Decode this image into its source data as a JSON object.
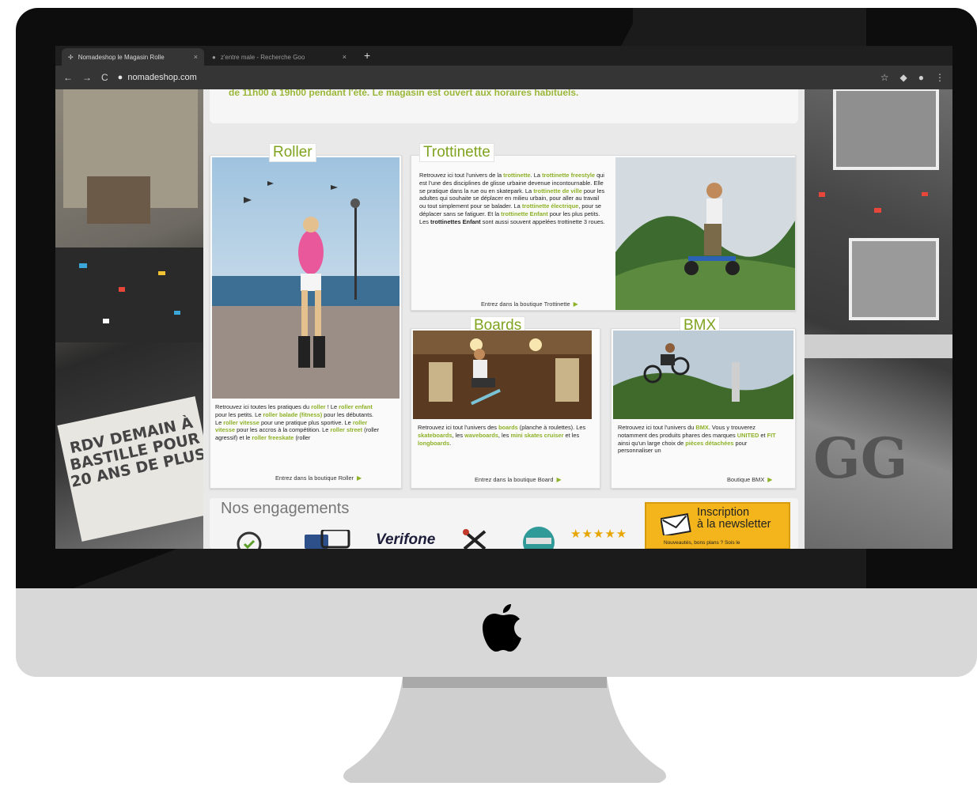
{
  "browser": {
    "tabs": [
      {
        "label": "Nomadeshop le Magasin Rolle",
        "active": true
      },
      {
        "label": "z'entre male - Recherche Goo",
        "active": false
      }
    ],
    "new_tab": "+",
    "url": "nomadeshop.com"
  },
  "page": {
    "top_banner_text": "de 11h00 à 19h00 pendant l'été. Le magasin est ouvert aux horaires habituels.",
    "background": {
      "rdv_sign": "RDV DEMAIN À BASTILLE POUR 20 ANS DE PLUS",
      "right_sign": "GG"
    },
    "sections": {
      "roller": {
        "title": "Roller",
        "text_parts": [
          {
            "t": "Retrouvez ici toutes les pratiques du ",
            "hl": false
          },
          {
            "t": "roller",
            "hl": true
          },
          {
            "t": " ! Le ",
            "hl": false
          },
          {
            "t": "roller enfant",
            "hl": true
          },
          {
            "t": " pour les petits. Le ",
            "hl": false
          },
          {
            "t": "roller balade (fitness)",
            "hl": true
          },
          {
            "t": " pour les débutants. Le ",
            "hl": false
          },
          {
            "t": "roller vitesse",
            "hl": true
          },
          {
            "t": " pour une pratique plus sportive. Le ",
            "hl": false
          },
          {
            "t": "roller vitesse",
            "hl": true
          },
          {
            "t": " pour les accros à la compétition. Le ",
            "hl": false
          },
          {
            "t": "roller street",
            "hl": true
          },
          {
            "t": " (roller agressif) et le ",
            "hl": false
          },
          {
            "t": "roller freeskate",
            "hl": true
          },
          {
            "t": " (roller",
            "hl": false
          }
        ],
        "link": "Entrez dans la boutique Roller"
      },
      "trottinette": {
        "title": "Trottinette",
        "text_parts": [
          {
            "t": "Retrouvez ici tout l'univers de la ",
            "hl": false
          },
          {
            "t": "trottinette",
            "hl": true
          },
          {
            "t": ". La ",
            "hl": false
          },
          {
            "t": "trottinette freestyle",
            "hl": true
          },
          {
            "t": " qui est l'une des disciplines de glisse urbaine devenue incontournable. Elle se pratique dans la rue ou en skatepark. La ",
            "hl": false
          },
          {
            "t": "trottinette de ville",
            "hl": true
          },
          {
            "t": " pour les adultes qui souhaite se déplacer en milieu urbain, pour aller au travail ou tout simplement pour se balader. La ",
            "hl": false
          },
          {
            "t": "trottinette électrique",
            "hl": true
          },
          {
            "t": ", pour se déplacer sans se fatiguer. Et la ",
            "hl": false
          },
          {
            "t": "trottinette Enfant",
            "hl": true
          },
          {
            "t": " pour les plus petits. Les ",
            "hl": false
          },
          {
            "t": "trottinettes Enfant",
            "hl": "bold"
          },
          {
            "t": " sont aussi souvent appelées trottinette 3 roues.",
            "hl": false
          }
        ],
        "link": "Entrez dans la boutique Trottinette"
      },
      "boards": {
        "title": "Boards",
        "text_parts": [
          {
            "t": "Retrouvez ici tout l'univers des ",
            "hl": false
          },
          {
            "t": "boards",
            "hl": true
          },
          {
            "t": " (planche à roulettes). Les ",
            "hl": false
          },
          {
            "t": "skateboards",
            "hl": true
          },
          {
            "t": ", les ",
            "hl": false
          },
          {
            "t": "waveboards",
            "hl": true
          },
          {
            "t": ", les ",
            "hl": false
          },
          {
            "t": "mini skates cruiser",
            "hl": true
          },
          {
            "t": " et les ",
            "hl": false
          },
          {
            "t": "longboards",
            "hl": true
          },
          {
            "t": ".",
            "hl": false
          }
        ],
        "link": "Entrez dans la boutique Board"
      },
      "bmx": {
        "title": "BMX",
        "text_parts": [
          {
            "t": "Retrouvez ici tout l'univers du ",
            "hl": false
          },
          {
            "t": "BMX",
            "hl": true
          },
          {
            "t": ". Vous y trouverez notamment des produits phares des marques ",
            "hl": false
          },
          {
            "t": "UNITED",
            "hl": true
          },
          {
            "t": " et ",
            "hl": false
          },
          {
            "t": "FIT",
            "hl": true
          },
          {
            "t": " ainsi qu'un large choix de ",
            "hl": false
          },
          {
            "t": "pièces détachées",
            "hl": true
          },
          {
            "t": " pour personnaliser un",
            "hl": false
          }
        ],
        "link": "Boutique BMX"
      }
    },
    "engagements": {
      "title": "Nos engagements",
      "verifone": "Verifone",
      "stars": "★★★★★"
    },
    "newsletter": {
      "title_line1": "Inscription",
      "title_line2": "à la newsletter",
      "subtitle": "Nouveautés, bons plans ? Sois le"
    }
  },
  "colors": {
    "accent_green": "#8db127",
    "newsletter_orange": "#f3b41c",
    "bezel": "#0d0d0d",
    "chin": "#d8d8d8"
  },
  "icons": [
    "reload-icon",
    "back-icon",
    "forward-icon",
    "lock-icon",
    "star-icon",
    "extension-icon",
    "profile-icon",
    "menu-icon",
    "apple-icon",
    "mail-icon"
  ]
}
